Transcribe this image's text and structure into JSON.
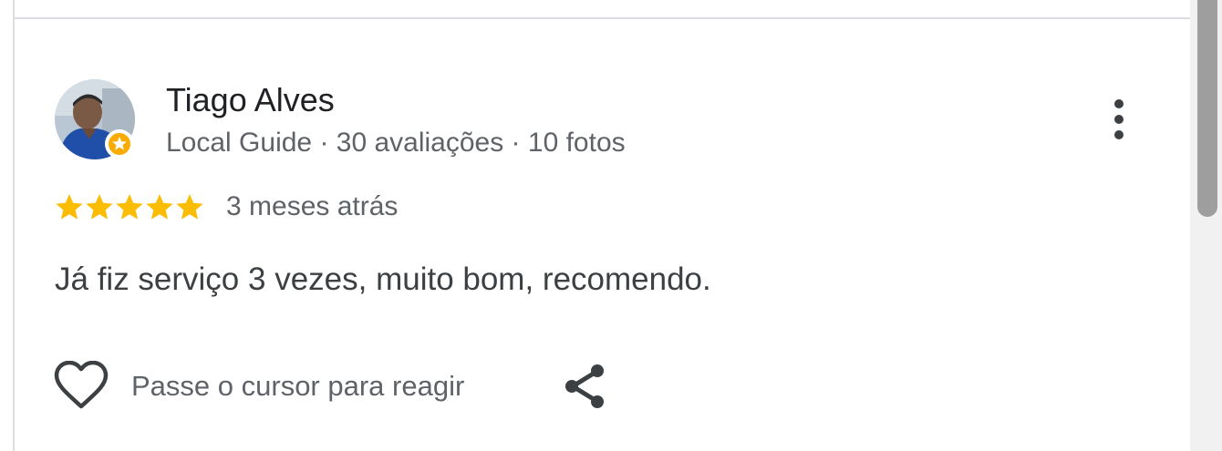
{
  "review": {
    "author_name": "Tiago Alves",
    "author_meta": "Local Guide · 30 avaliações · 10 fotos",
    "rating": 5,
    "rating_max": 5,
    "date": "3 meses atrás",
    "text": "Já fiz serviço 3 vezes, muito bom, recomendo.",
    "react_label": "Passe o cursor para reagir"
  },
  "colors": {
    "star": "#fbbc04",
    "icon": "#3c4043",
    "divider": "#dadce0",
    "local_guide_badge": "#f9ab00"
  },
  "icons": {
    "more": "more-vert-icon",
    "like": "heart-outline-icon",
    "share": "share-icon",
    "badge": "local-guide-badge-icon",
    "star": "star-icon"
  }
}
